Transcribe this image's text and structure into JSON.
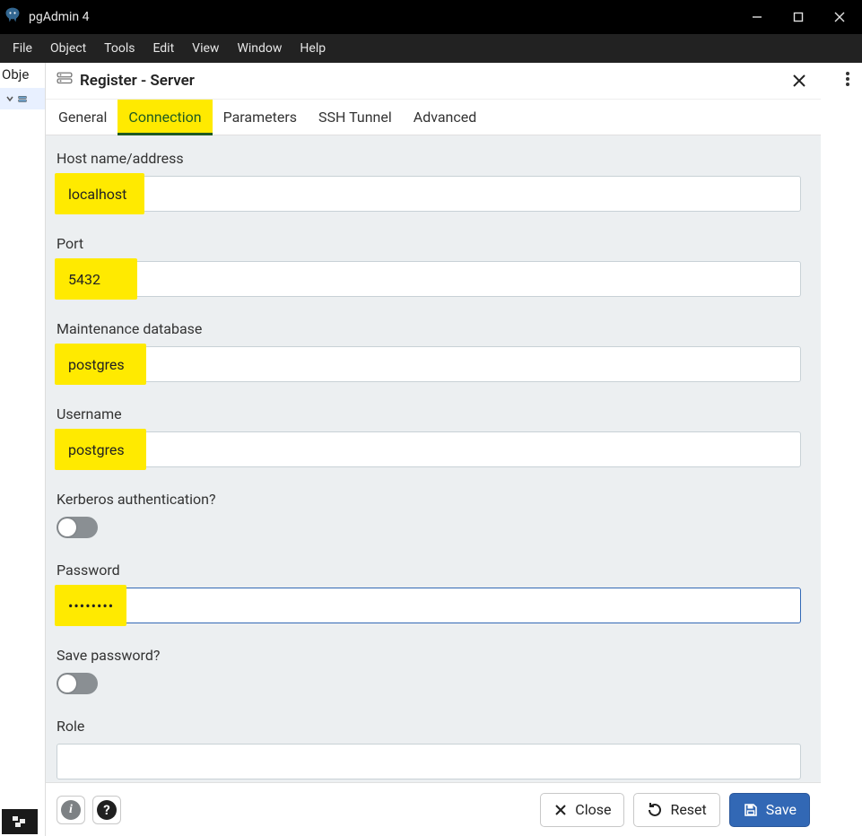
{
  "window": {
    "title": "pgAdmin 4"
  },
  "menus": [
    "File",
    "Object",
    "Tools",
    "Edit",
    "View",
    "Window",
    "Help"
  ],
  "sidebar": {
    "header": "Obje"
  },
  "dialog": {
    "title": "Register - Server",
    "tabs": [
      "General",
      "Connection",
      "Parameters",
      "SSH Tunnel",
      "Advanced"
    ],
    "active_tab_index": 1,
    "fields": {
      "host_label": "Host name/address",
      "host_value": "localhost",
      "port_label": "Port",
      "port_value": "5432",
      "maintdb_label": "Maintenance database",
      "maintdb_value": "postgres",
      "user_label": "Username",
      "user_value": "postgres",
      "kerberos_label": "Kerberos authentication?",
      "password_label": "Password",
      "password_value": "••••••••",
      "savepwd_label": "Save password?",
      "role_label": "Role",
      "role_value": ""
    },
    "buttons": {
      "close": "Close",
      "reset": "Reset",
      "save": "Save"
    }
  }
}
